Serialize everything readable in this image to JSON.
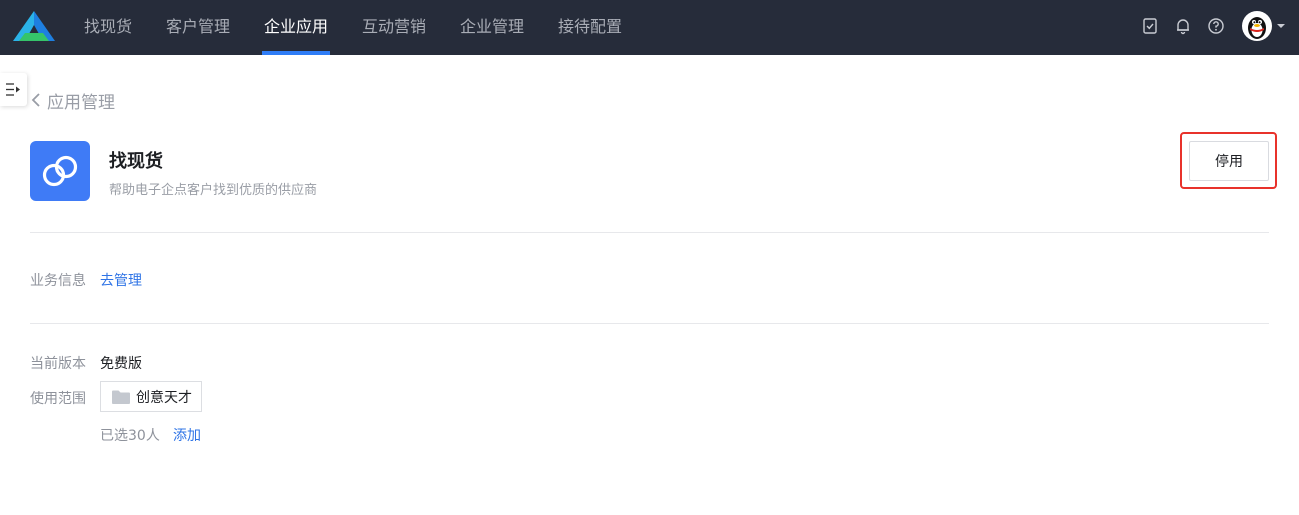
{
  "nav": {
    "items": [
      {
        "label": "找现货",
        "active": false
      },
      {
        "label": "客户管理",
        "active": false
      },
      {
        "label": "企业应用",
        "active": true
      },
      {
        "label": "互动营销",
        "active": false
      },
      {
        "label": "企业管理",
        "active": false
      },
      {
        "label": "接待配置",
        "active": false
      }
    ],
    "icons": [
      "task-icon",
      "bell-icon",
      "help-icon"
    ]
  },
  "breadcrumb": {
    "back_label": "应用管理"
  },
  "app": {
    "name": "找现货",
    "description": "帮助电子企点客户找到优质的供应商",
    "disable_label": "停用",
    "icon": "link-icon"
  },
  "business": {
    "label": "业务信息",
    "manage_link": "去管理"
  },
  "version": {
    "label": "当前版本",
    "value": "免费版"
  },
  "scope": {
    "label": "使用范围",
    "org_tag": "创意天才",
    "selected_text": "已选30人",
    "add_link": "添加"
  },
  "colors": {
    "topbar": "#262c3a",
    "accent": "#2f7df6",
    "app_icon": "#3f7bf6",
    "highlight": "#e8322b",
    "link": "#2f74e6"
  }
}
